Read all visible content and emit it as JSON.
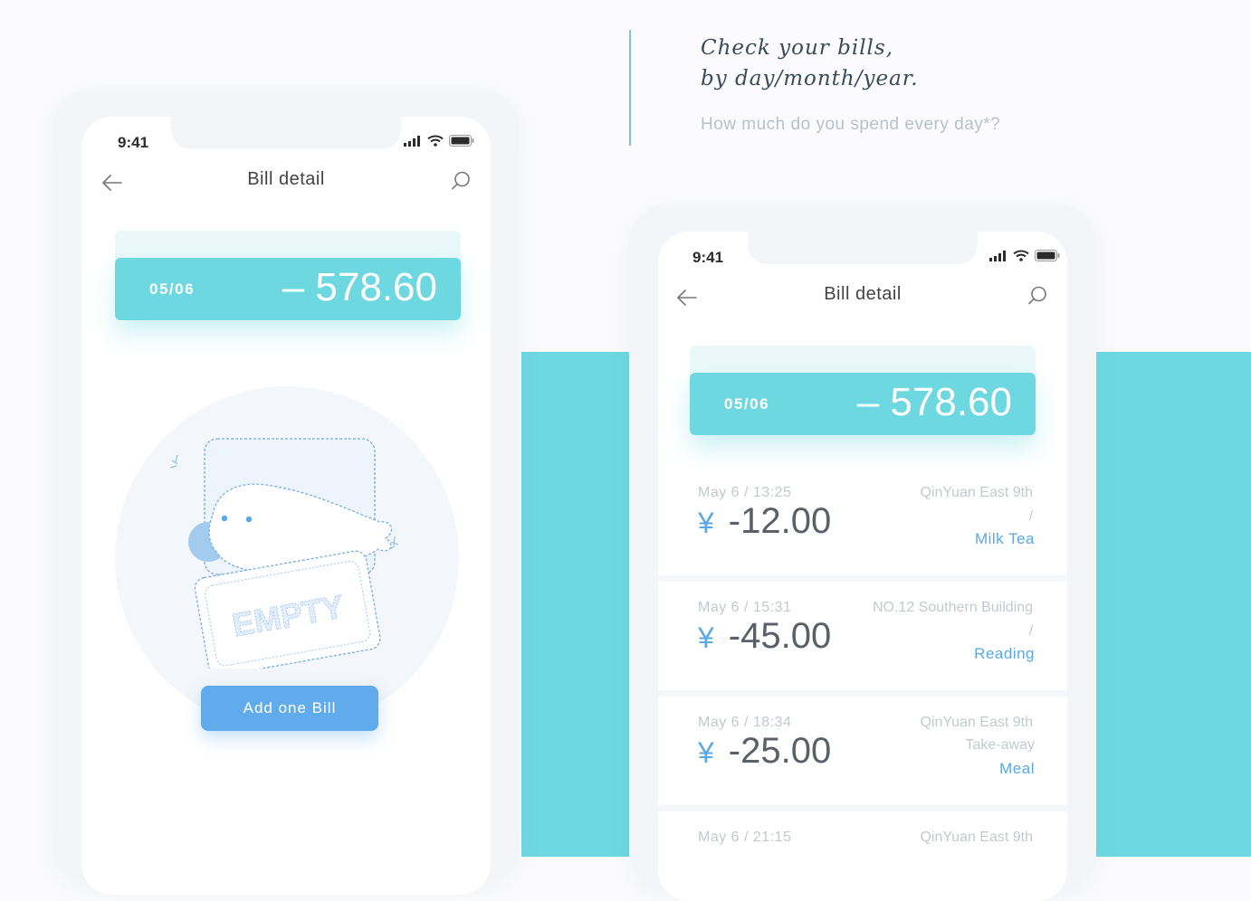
{
  "header": {
    "headline_line1": "Check your bills,",
    "headline_line2": "by day/month/year.",
    "subline": "How much do you spend every day*?"
  },
  "phone_empty": {
    "status_time": "9:41",
    "nav_title": "Bill detail",
    "summary": {
      "date": "05/06",
      "amount": "– 578.60"
    },
    "empty_label": "EMPTY",
    "add_button": "Add one Bill"
  },
  "phone_list": {
    "status_time": "9:41",
    "nav_title": "Bill detail",
    "summary": {
      "date": "05/06",
      "amount": "– 578.60"
    },
    "bills": [
      {
        "time": "May 6 / 13:25",
        "currency": "¥",
        "amount": "-12.00",
        "place": "QinYuan East 9th",
        "separator": "/",
        "sub": "",
        "category": "Milk Tea"
      },
      {
        "time": "May 6 / 15:31",
        "currency": "¥",
        "amount": "-45.00",
        "place": "NO.12 Southern Building",
        "separator": "/",
        "sub": "",
        "category": "Reading"
      },
      {
        "time": "May 6 / 18:34",
        "currency": "¥",
        "amount": "-25.00",
        "place": "QinYuan East 9th",
        "separator": "",
        "sub": "Take-away",
        "category": "Meal"
      },
      {
        "time": "May 6 / 21:15",
        "currency": "",
        "amount": "",
        "place": "QinYuan East 9th",
        "separator": "",
        "sub": "",
        "category": ""
      }
    ]
  },
  "colors": {
    "teal": "#6ed8e1",
    "blue_accent": "#5aa8e6",
    "button_blue": "#60abec",
    "page_background": "#fbfbfd"
  },
  "icons": [
    "back-arrow-icon",
    "search-icon",
    "signal-icon",
    "wifi-icon",
    "battery-icon"
  ]
}
